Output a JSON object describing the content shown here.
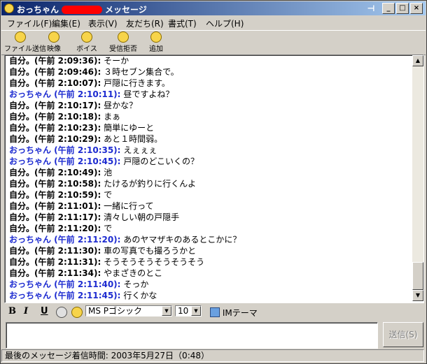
{
  "window": {
    "title_name": "おっちゃん",
    "title_suffix": "メッセージ"
  },
  "menu": [
    "ファイル(F)",
    "編集(E)",
    "表示(V)",
    "友だち(R)",
    "書式(T)",
    "ヘルプ(H)"
  ],
  "toolbar": [
    {
      "label": "ファイル送信",
      "icon": "file-send-icon"
    },
    {
      "label": "映像",
      "icon": "video-icon"
    },
    {
      "label": "ボイス",
      "icon": "voice-icon"
    },
    {
      "label": "受信拒否",
      "icon": "block-icon"
    },
    {
      "label": "追加",
      "icon": "add-friend-icon"
    }
  ],
  "messages": [
    {
      "who": "自分。(午前 2:09:36):",
      "self": true,
      "text": "そーか"
    },
    {
      "who": "自分。(午前 2:09:46):",
      "self": true,
      "text": "３時セブン集合で。"
    },
    {
      "who": "自分。(午前 2:10:07):",
      "self": true,
      "text": "戸隠に行きます。"
    },
    {
      "who": "おっちゃん (午前 2:10:11):",
      "self": false,
      "text": "昼ですよね？"
    },
    {
      "who": "自分。(午前 2:10:17):",
      "self": true,
      "text": "昼かな？"
    },
    {
      "who": "自分。(午前 2:10:18):",
      "self": true,
      "text": "まぁ"
    },
    {
      "who": "自分。(午前 2:10:23):",
      "self": true,
      "text": "簡単にゆーと"
    },
    {
      "who": "自分。(午前 2:10:29):",
      "self": true,
      "text": "あと１時間弱。"
    },
    {
      "who": "おっちゃん (午前 2:10:35):",
      "self": false,
      "text": "えぇぇぇ"
    },
    {
      "who": "おっちゃん (午前 2:10:45):",
      "self": false,
      "text": "戸隠のどこいくの？"
    },
    {
      "who": "自分。(午前 2:10:49):",
      "self": true,
      "text": "池"
    },
    {
      "who": "自分。(午前 2:10:58):",
      "self": true,
      "text": "たけるが釣りに行くんよ"
    },
    {
      "who": "自分。(午前 2:10:59):",
      "self": true,
      "text": "で"
    },
    {
      "who": "自分。(午前 2:11:01):",
      "self": true,
      "text": "一緒に行って"
    },
    {
      "who": "自分。(午前 2:11:17):",
      "self": true,
      "text": "清々しい朝の戸隠手"
    },
    {
      "who": "自分。(午前 2:11:20):",
      "self": true,
      "text": "                              で"
    },
    {
      "who": "おっちゃん (午前 2:11:20):",
      "self": false,
      "text": "あのヤマザキのあるとこかに？"
    },
    {
      "who": "自分。(午前 2:11:30):",
      "self": true,
      "text": "車の写真でも撮ろうかと"
    },
    {
      "who": "自分。(午前 2:11:31):",
      "self": true,
      "text": "そうそうそうそうそうそう"
    },
    {
      "who": "自分。(午前 2:11:34):",
      "self": true,
      "text": "やまざきのとこ"
    },
    {
      "who": "おっちゃん (午前 2:11:40):",
      "self": false,
      "text": "そっか"
    },
    {
      "who": "おっちゃん (午前 2:11:45):",
      "self": false,
      "text": "行くかな"
    }
  ],
  "format": {
    "bold": "B",
    "italic": "I",
    "underline": "U",
    "font": "MS Pゴシック",
    "size": "10",
    "theme": "IMテーマ"
  },
  "send_label": "送信(S)",
  "status": "最後のメッセージ着信時間: 2003年5月27日（0:48）"
}
